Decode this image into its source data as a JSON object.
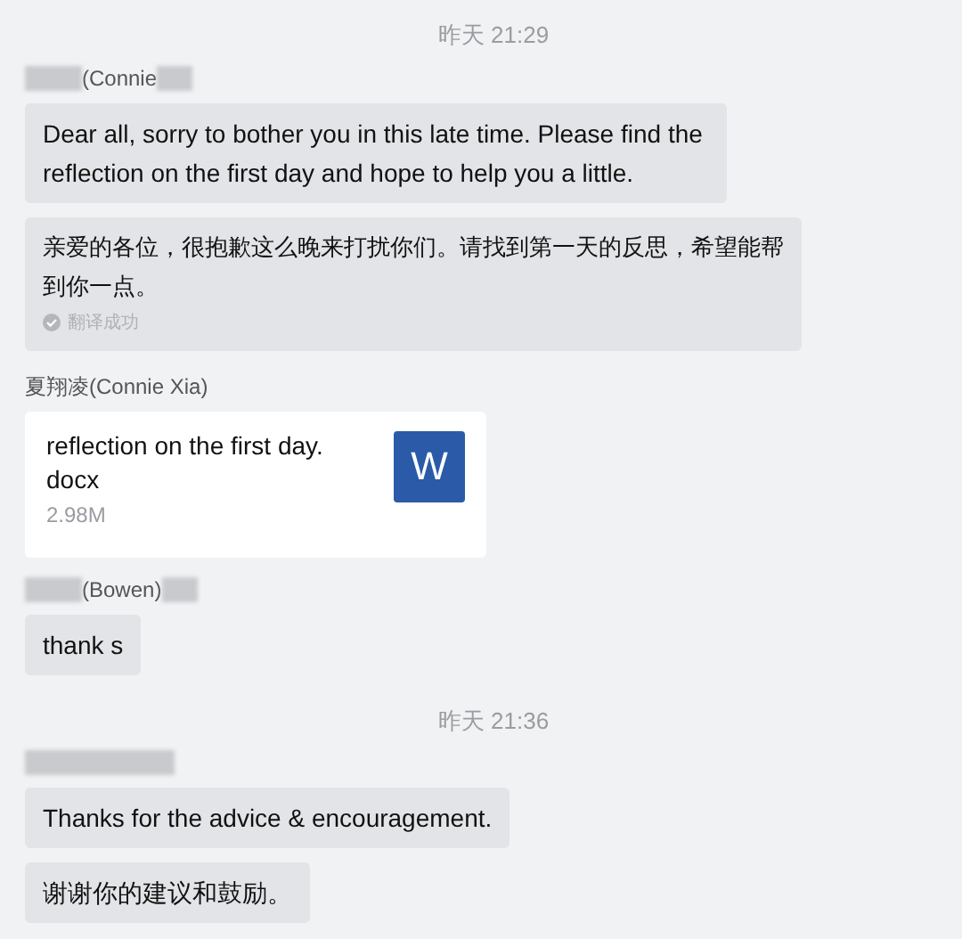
{
  "messages": [
    {
      "kind": "time",
      "text": "昨天 21:29"
    },
    {
      "kind": "sender",
      "text": "(Connie",
      "redacted": true
    },
    {
      "kind": "text",
      "text": "Dear all, sorry to bother you in this late time. Please find the reflection on the first day and hope to help you a little."
    },
    {
      "kind": "translation",
      "text": "亲爱的各位，很抱歉这么晚来打扰你们。请找到第一天的反思，希望能帮到你一点。",
      "status": "翻译成功"
    },
    {
      "kind": "sender",
      "text": "夏翔凌(Connie Xia)",
      "redacted": false
    },
    {
      "kind": "file",
      "name": "reflection on the first day.\ndocx",
      "size": "2.98M",
      "badge": "W"
    },
    {
      "kind": "sender",
      "text": "(Bowen)",
      "redacted": true
    },
    {
      "kind": "text",
      "text": "thank s"
    },
    {
      "kind": "time",
      "text": "昨天 21:36"
    },
    {
      "kind": "sender",
      "redacted": true
    },
    {
      "kind": "text",
      "text": "Thanks for the advice & encouragement."
    },
    {
      "kind": "text",
      "text": "谢谢你的建议和鼓励。"
    }
  ]
}
